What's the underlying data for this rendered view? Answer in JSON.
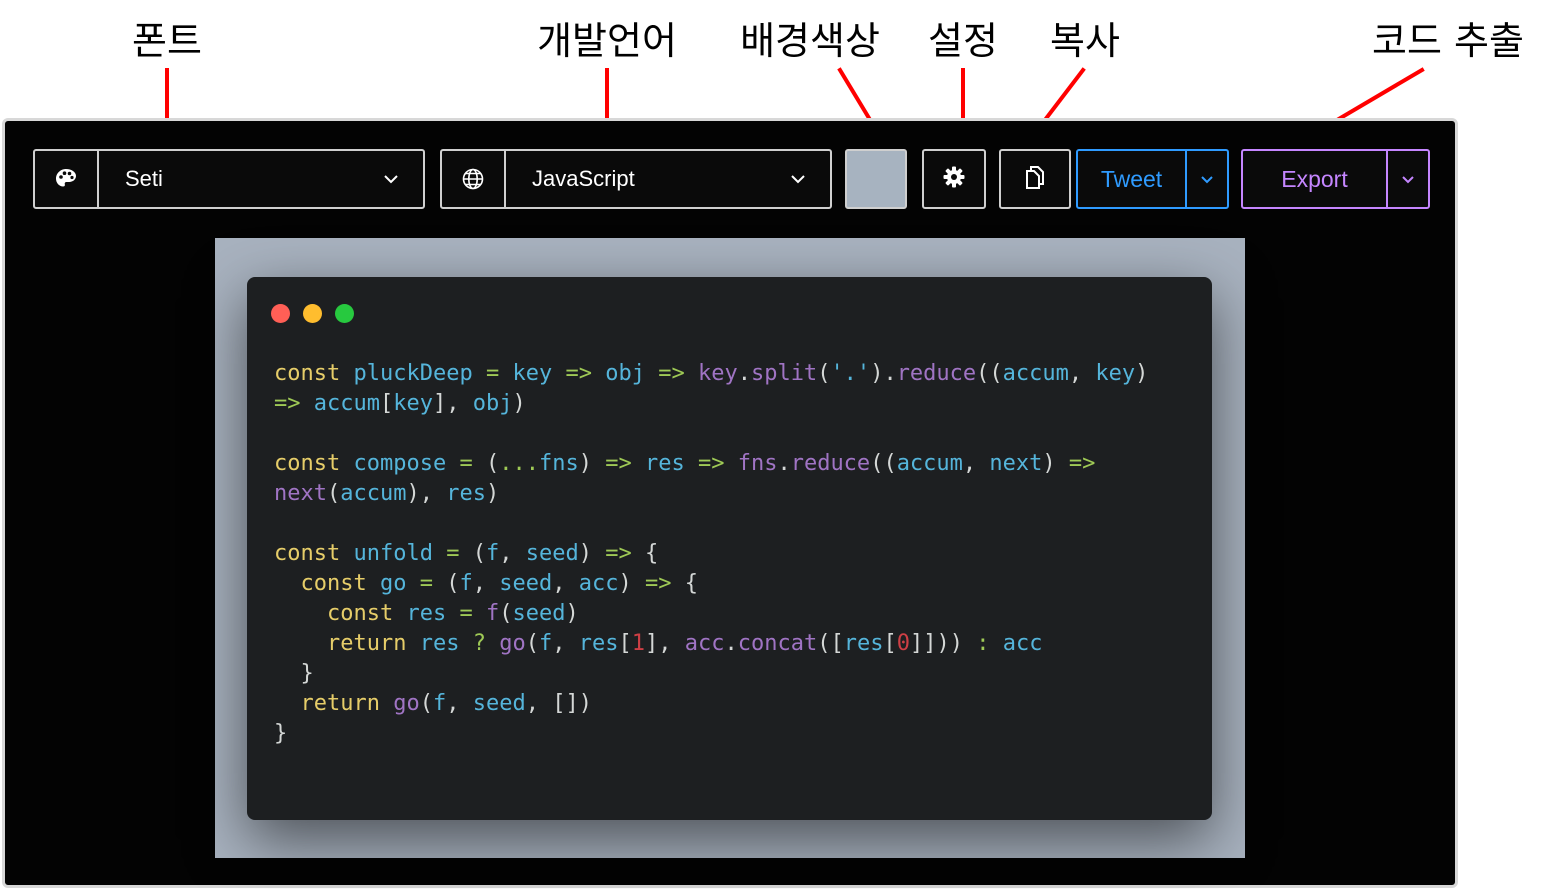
{
  "annotations": {
    "font": "폰트",
    "language": "개발언어",
    "background": "배경색상",
    "settings": "설정",
    "copy": "복사",
    "export_code": "코드 추출"
  },
  "toolbar": {
    "theme_value": "Seti",
    "language_value": "JavaScript",
    "background_color": "#a7b3c0",
    "tweet_label": "Tweet",
    "export_label": "Export",
    "tweet_color": "#2f9bff",
    "export_color": "#c586ff"
  },
  "window_controls": {
    "close_color": "#ff5f56",
    "minimize_color": "#ffbd2e",
    "maximize_color": "#27c93f"
  },
  "code": {
    "language": "JavaScript",
    "lines": [
      "const pluckDeep = key => obj => key.split('.').reduce((accum, key)",
      "=> accum[key], obj)",
      "",
      "const compose = (...fns) => res => fns.reduce((accum, next) =>",
      "next(accum), res)",
      "",
      "const unfold = (f, seed) => {",
      "  const go = (f, seed, acc) => {",
      "    const res = f(seed)",
      "    return res ? go(f, res[1], acc.concat([res[0]])) : acc",
      "  }",
      "  return go(f, seed, [])",
      "}"
    ]
  }
}
